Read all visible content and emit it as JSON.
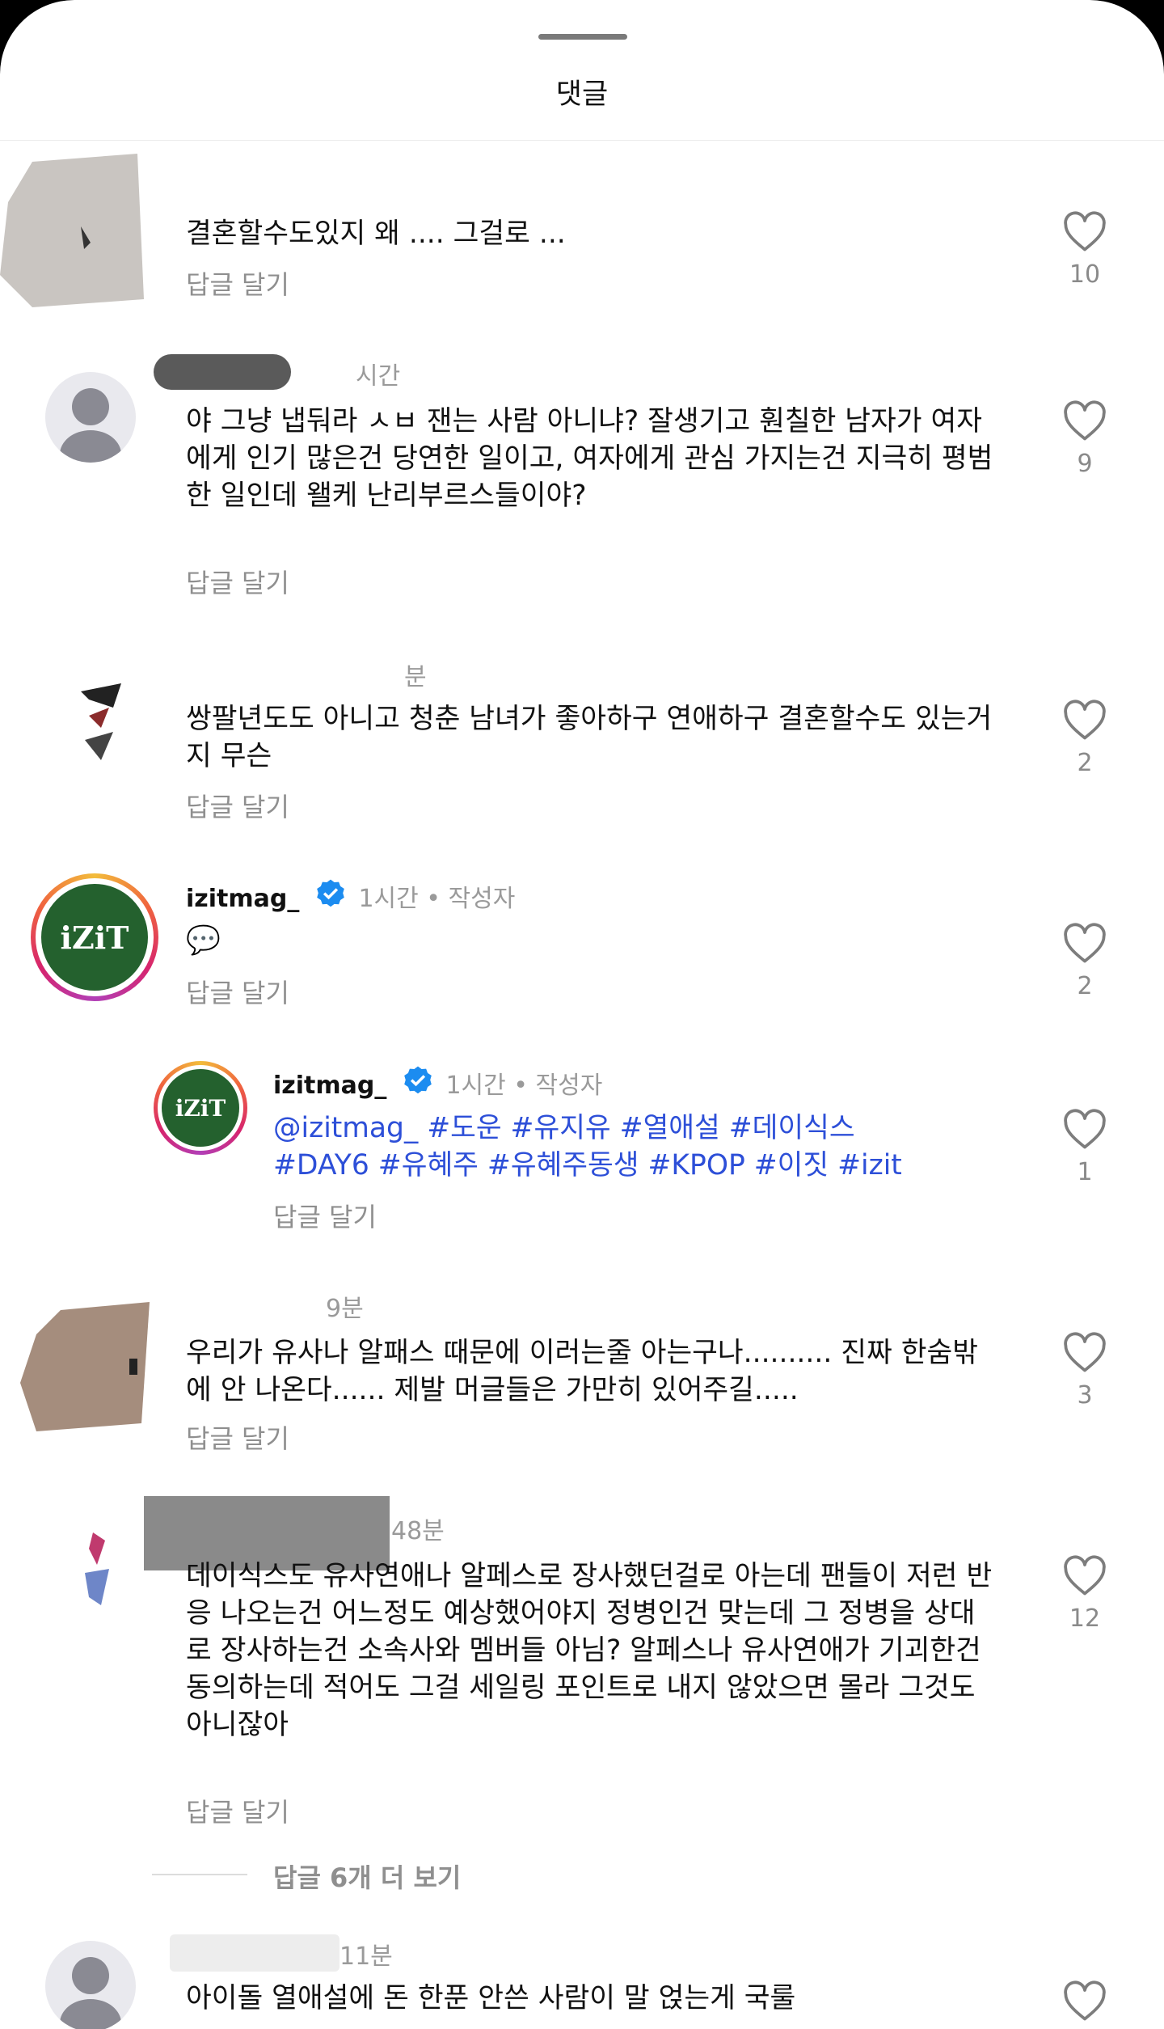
{
  "sheet": {
    "title": "댓글"
  },
  "common": {
    "reply_label": "답글 달기",
    "author_tag": "작성자"
  },
  "comments": [
    {
      "meta": "",
      "text": "결혼할수도있지 왜 .... 그걸로 ...",
      "likes": "10"
    },
    {
      "meta": "시간",
      "text": "야 그냥 냅둬라 ㅅㅂ 잰는 사람 아니냐? 잘생기고 훤칠한 남자가 여자에게 인기 많은건 당연한 일이고, 여자에게 관심 가지는건 지극히 평범한 일인데 왤케 난리부르스들이야?",
      "likes": "9"
    },
    {
      "meta": "분",
      "text": "쌍팔년도도 아니고 청춘 남녀가 좋아하구 연애하구 결혼할수도 있는거지 무슨",
      "likes": "2"
    },
    {
      "username": "izitmag_",
      "time": "1시간",
      "is_author": true,
      "text": "💬",
      "likes": "2",
      "avatar_text": "iZiT"
    },
    {
      "username": "izitmag_",
      "time": "1시간",
      "is_author": true,
      "tags_line1": [
        "@izitmag_",
        "#도운",
        "#유지유",
        "#열애설",
        "#데이식스"
      ],
      "tags_line2": [
        "#DAY6",
        "#유혜주",
        "#유혜주동생",
        "#KPOP",
        "#이짓",
        "#izit"
      ],
      "likes": "1",
      "avatar_text": "iZiT"
    },
    {
      "meta": "9분",
      "text": "우리가 유사나 알패스 때문에 이러는줄 아는구나.......... 진짜 한숨밖에 안 나온다...... 제발 머글들은 가만히 있어주길.....",
      "likes": "3"
    },
    {
      "meta": "48분",
      "text": "데이식스도 유사연애나 알페스로 장사했던걸로 아는데 팬들이 저런 반응 나오는건 어느정도 예상했어야지 정병인건 맞는데 그 정병을 상대로 장사하는건 소속사와 멤버들 아님? 알페스나 유사연애가 기괴한건 동의하는데 적어도 그걸 세일링 포인트로 내지 않았으면 몰라 그것도 아니잖아",
      "likes": "12"
    },
    {
      "meta": "11분",
      "text": "아이돌 열애설에 돈 한푼 안쓴 사람이 말 얹는게 국룰",
      "likes": ""
    }
  ],
  "more_replies": "답글 6개 더 보기"
}
